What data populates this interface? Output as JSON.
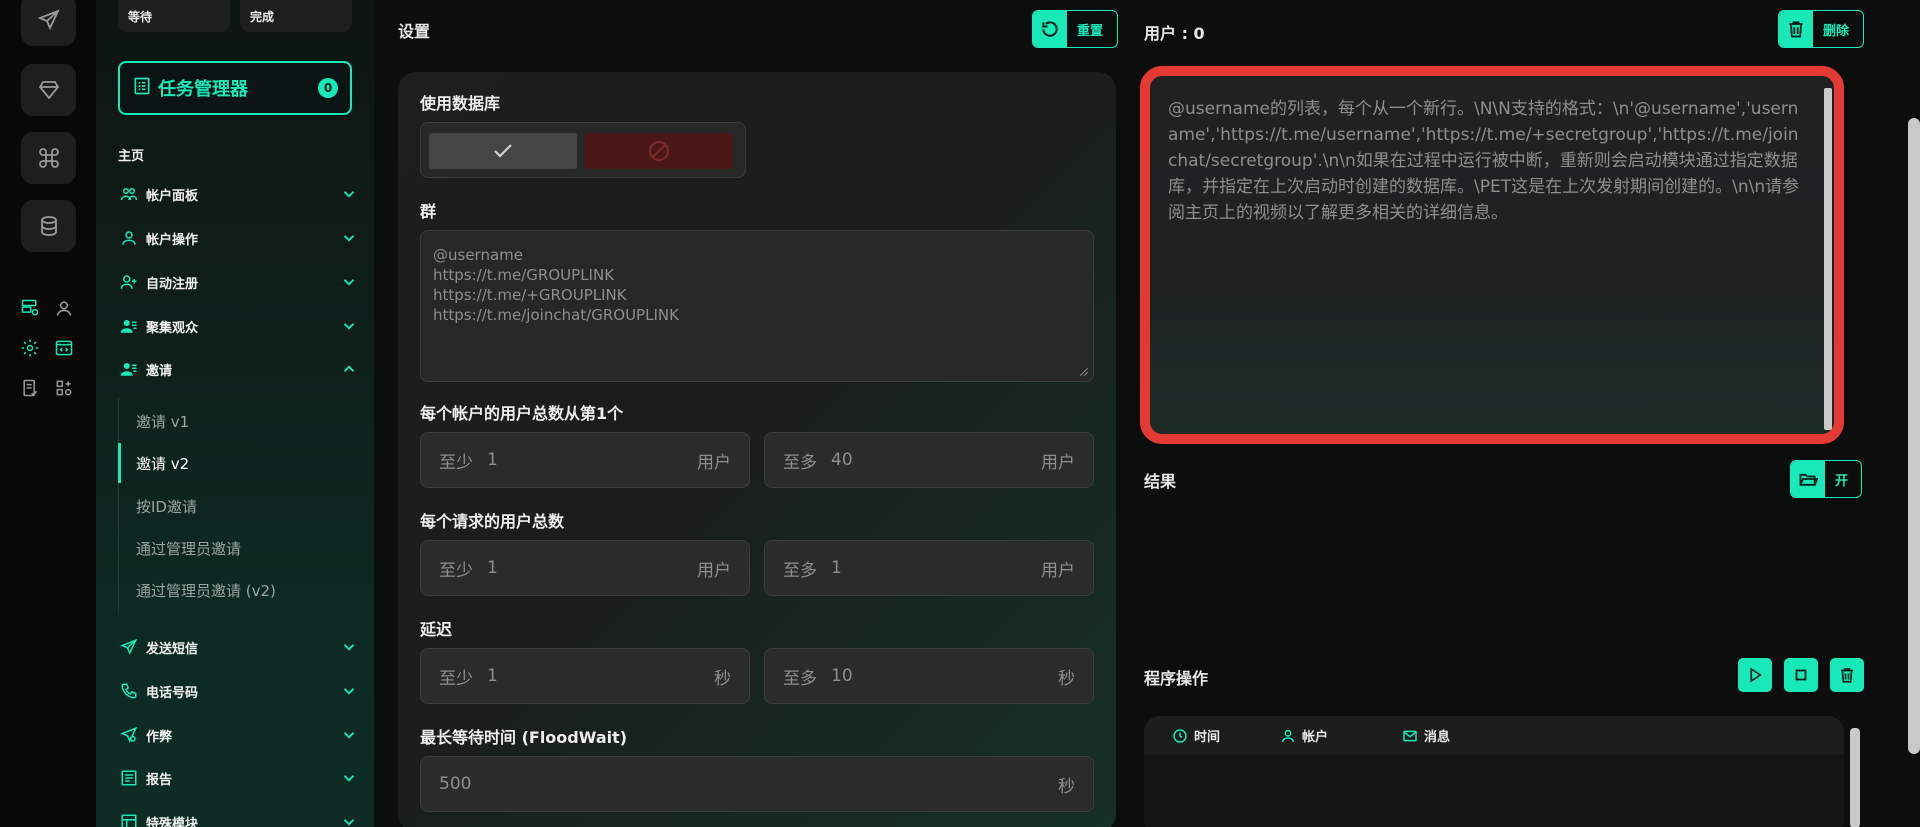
{
  "colors": {
    "accent": "#19e8b8",
    "danger": "#e53a34",
    "bg": "#0c0d0d"
  },
  "rail": {
    "icons": [
      "send-icon",
      "diamond-icon",
      "command-icon",
      "database-icon",
      "server-settings-icon",
      "map-pin-icon",
      "gear-icon",
      "code-window-icon",
      "checklist-icon",
      "modules-icon"
    ]
  },
  "sidebar": {
    "stats": {
      "waiting": "等待",
      "done": "完成"
    },
    "task_manager": {
      "label": "任务管理器",
      "count": "0"
    },
    "home": "主页",
    "items": [
      {
        "label": "帐户面板",
        "icon": "users-icon"
      },
      {
        "label": "帐户操作",
        "icon": "user-icon"
      },
      {
        "label": "自动注册",
        "icon": "user-plus-icon"
      },
      {
        "label": "聚集观众",
        "icon": "user-group-icon"
      },
      {
        "label": "邀请",
        "icon": "user-group-icon"
      },
      {
        "label": "发送短信",
        "icon": "send-icon"
      },
      {
        "label": "电话号码",
        "icon": "phone-icon"
      },
      {
        "label": "作弊",
        "icon": "send-gear-icon"
      },
      {
        "label": "报告",
        "icon": "report-icon"
      },
      {
        "label": "特殊模块",
        "icon": "module-icon"
      }
    ],
    "invite_sub": [
      "邀请 v1",
      "邀请 v2",
      "按ID邀请",
      "通过管理员邀请",
      "通过管理员邀请 (v2)"
    ]
  },
  "settings": {
    "title": "设置",
    "reset_label": "重置",
    "use_db_label": "使用数据库",
    "group_label": "群",
    "group_placeholder": "@username\nhttps://t.me/GROUPLINK\nhttps://t.me/+GROUPLINK\nhttps://t.me/joinchat/GROUPLINK",
    "per_account_label": "每个帐户的用户总数从第1个",
    "per_account": {
      "min_prefix": "至少",
      "min": "1",
      "max_prefix": "至多",
      "max": "40",
      "unit": "用户"
    },
    "per_request_label": "每个请求的用户总数",
    "per_request": {
      "min_prefix": "至少",
      "min": "1",
      "max_prefix": "至多",
      "max": "1",
      "unit": "用户"
    },
    "delay_label": "延迟",
    "delay": {
      "min_prefix": "至少",
      "min": "1",
      "max_prefix": "至多",
      "max": "10",
      "unit": "秒"
    },
    "floodwait_label": "最长等待时间 (FloodWait)",
    "floodwait": {
      "value": "500",
      "unit": "秒"
    }
  },
  "right": {
    "users_title": "用户 : 0",
    "delete_label": "删除",
    "users_placeholder": "@username的列表，每个从一个新行。\\N\\N支持的格式：\\n'@username','username','https://t.me/username','https://t.me/+secretgroup','https://t.me/joinchat/secretgroup'.\\n\\n如果在过程中运行被中断，重新则会启动模块通过指定数据库，并指定在上次启动时创建的数据库。\\PET这是在上次发射期间创建的。\\n\\n请参阅主页上的视频以了解更多相关的详细信息。",
    "results_title": "结果",
    "open_label": "开",
    "ops_title": "程序操作",
    "log_cols": [
      "时间",
      "帐户",
      "消息"
    ]
  }
}
